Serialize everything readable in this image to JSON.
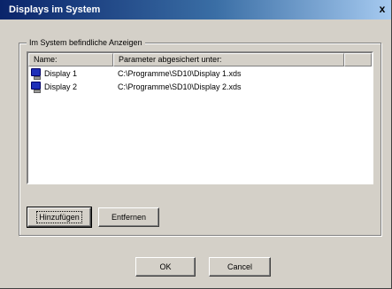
{
  "window": {
    "title": "Displays im System",
    "close_glyph": "x"
  },
  "group": {
    "legend": "Im System befindliche Anzeigen"
  },
  "list": {
    "columns": [
      "Name:",
      "Parameter abgesichert unter:",
      ""
    ],
    "rows": [
      {
        "icon": "display-icon",
        "name": "Display 1",
        "path": "C:\\Programme\\SD10\\Display 1.xds"
      },
      {
        "icon": "display-icon",
        "name": "Display 2",
        "path": "C:\\Programme\\SD10\\Display 2.xds"
      }
    ]
  },
  "buttons": {
    "add": "Hinzufügen",
    "remove": "Entfernen",
    "ok": "OK",
    "cancel": "Cancel"
  },
  "colors": {
    "dialog_face": "#d4d0c8",
    "title_start": "#0a246a",
    "title_end": "#a6caf0",
    "icon_screen": "#1e2fb8"
  }
}
